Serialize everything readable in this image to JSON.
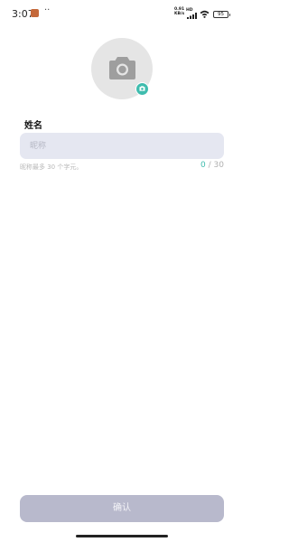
{
  "status_bar": {
    "time": "3:07",
    "dots": "··",
    "net_speed_value": "0.91",
    "net_speed_unit": "KB/s",
    "hd_label": "HD",
    "battery": "95"
  },
  "profile": {
    "avatar_icon": "camera-icon",
    "badge_icon": "camera-icon",
    "badge_color": "#3fbcae"
  },
  "form": {
    "name_label": "姓名",
    "name_placeholder": "昵称",
    "name_value": "",
    "hint": "昵称最多 30 个字元。",
    "char_count": "0",
    "char_separator": " / ",
    "char_max": "30"
  },
  "footer": {
    "confirm_label": "确认"
  },
  "colors": {
    "accent": "#3fbcae",
    "input_bg": "#e5e7f1",
    "button_disabled": "#b8b9cc"
  }
}
